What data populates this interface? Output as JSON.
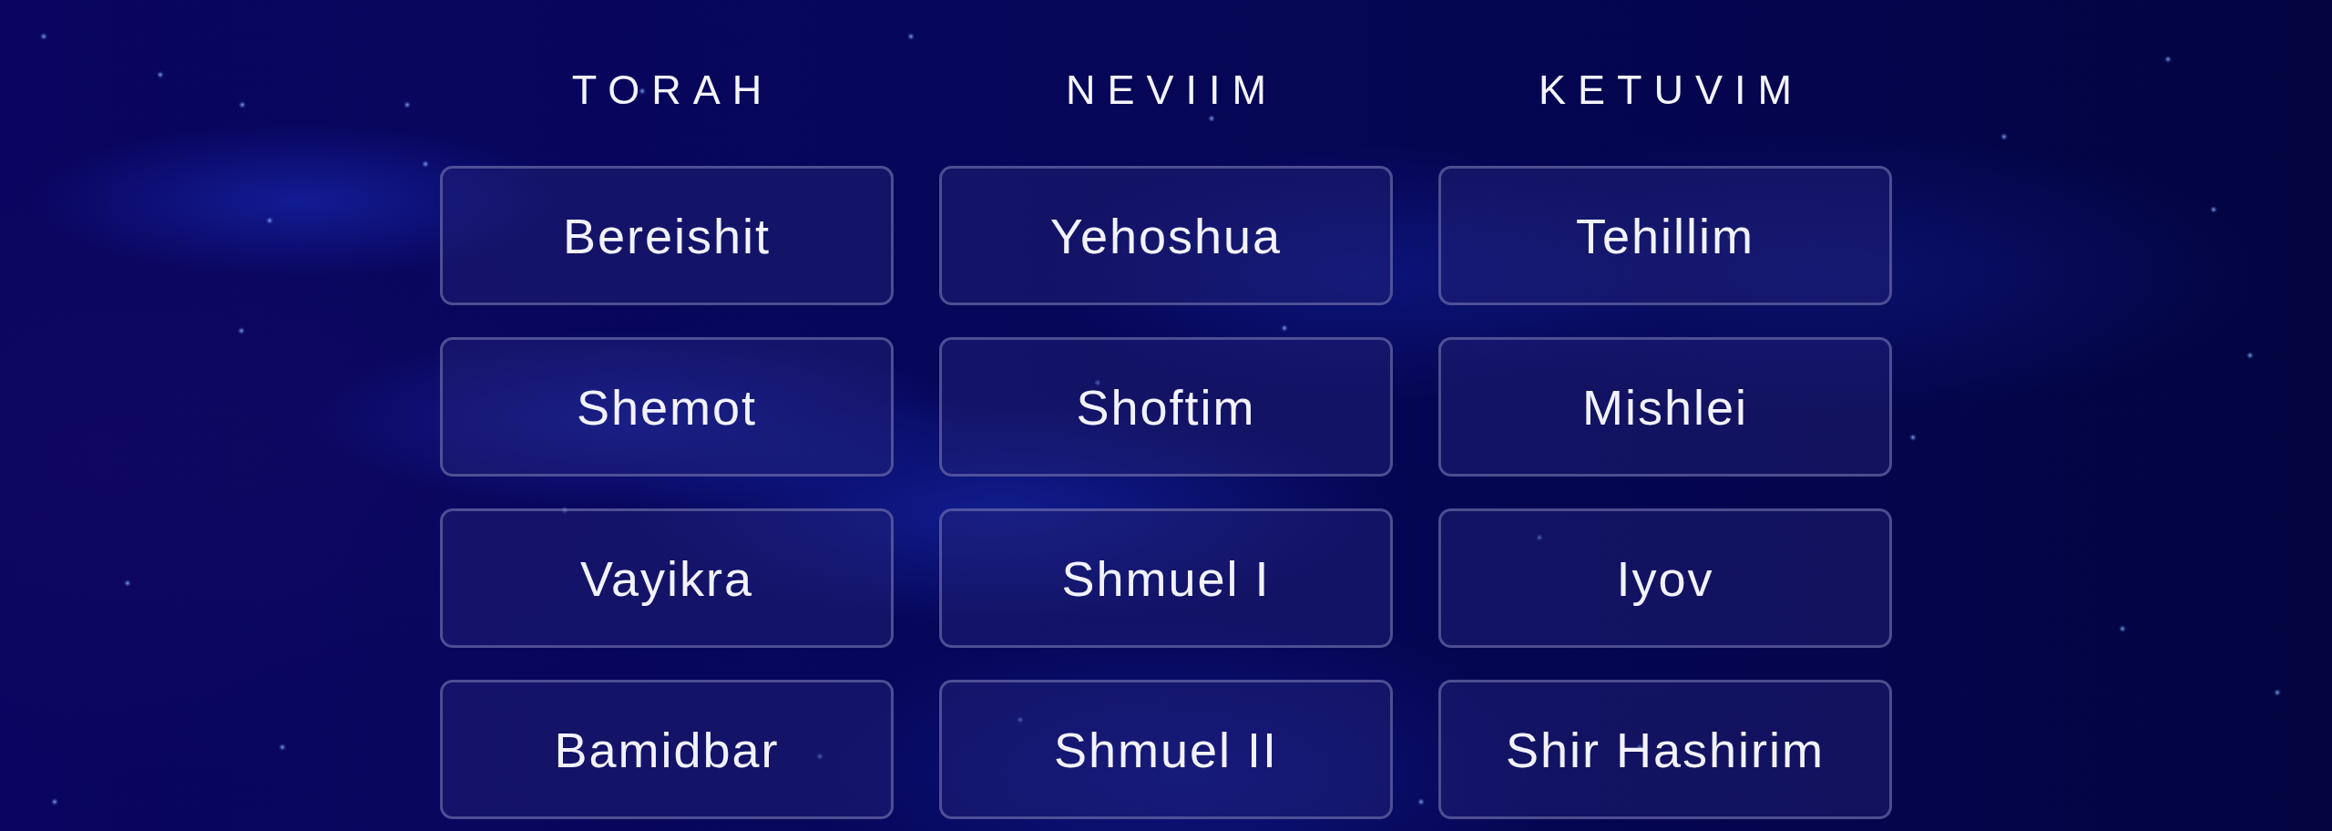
{
  "columns": [
    {
      "heading": "TORAH",
      "books": [
        "Bereishit",
        "Shemot",
        "Vayikra",
        "Bamidbar"
      ]
    },
    {
      "heading": "NEVIIM",
      "books": [
        "Yehoshua",
        "Shoftim",
        "Shmuel I",
        "Shmuel II"
      ]
    },
    {
      "heading": "KETUVIM",
      "books": [
        "Tehillim",
        "Mishlei",
        "Iyov",
        "Shir Hashirim"
      ]
    }
  ]
}
